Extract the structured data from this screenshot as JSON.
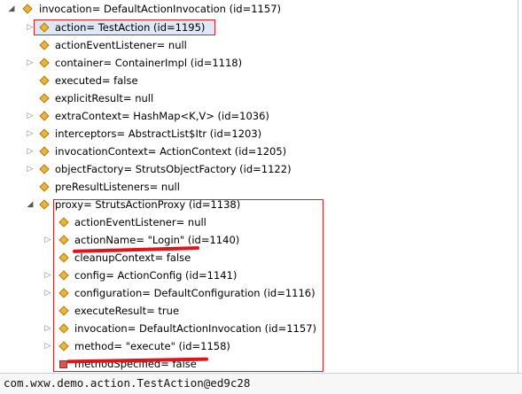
{
  "tree": {
    "root": "invocation= DefaultActionInvocation  (id=1157)",
    "items": [
      "action= TestAction  (id=1195)",
      "actionEventListener= null",
      "container= ContainerImpl  (id=1118)",
      "executed= false",
      "explicitResult= null",
      "extraContext= HashMap<K,V>  (id=1036)",
      "interceptors= AbstractList$Itr  (id=1203)",
      "invocationContext= ActionContext  (id=1205)",
      "objectFactory= StrutsObjectFactory  (id=1122)",
      "preResultListeners= null",
      "proxy= StrutsActionProxy  (id=1138)"
    ],
    "proxy_children": [
      "actionEventListener= null",
      "actionName= \"Login\" (id=1140)",
      "cleanupContext= false",
      "config= ActionConfig  (id=1141)",
      "configuration= DefaultConfiguration  (id=1116)",
      "executeResult= true",
      "invocation= DefaultActionInvocation  (id=1157)",
      "method= \"execute\" (id=1158)",
      "methodSpecified= false"
    ]
  },
  "status_bar": {
    "text": "com.wxw.demo.action.TestAction@ed9c28"
  },
  "colors": {
    "highlight": "#e02020",
    "selection": "#dfe8f6",
    "field_icon": "#e9b53c"
  },
  "icons": {
    "expand": "triangle-right-icon",
    "collapse": "triangle-down-icon",
    "field": "diamond-field-icon",
    "private_field": "red-square-icon"
  }
}
